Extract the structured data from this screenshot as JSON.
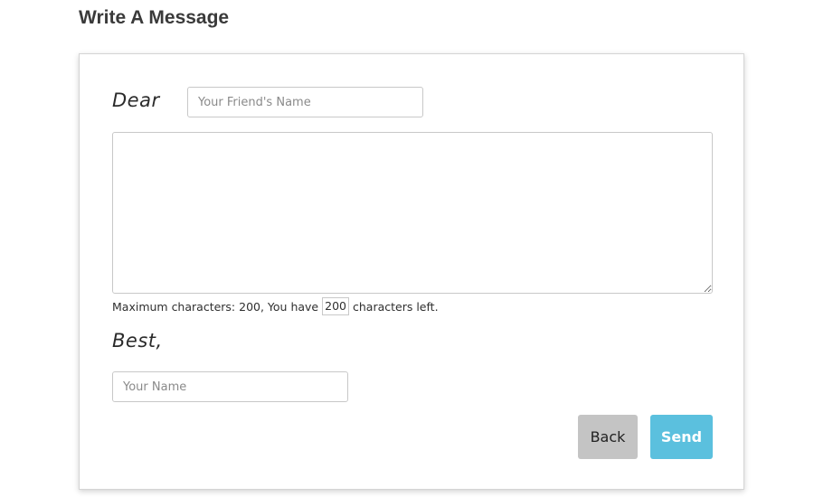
{
  "page": {
    "title": "Write A Message"
  },
  "form": {
    "greeting_label": "Dear",
    "friend_name_placeholder": "Your Friend's Name",
    "friend_name_value": "",
    "message_value": "",
    "counter": {
      "prefix": "Maximum characters: 200, You have",
      "remaining": "200",
      "suffix": "characters left."
    },
    "closing_label": "Best,",
    "your_name_placeholder": "Your Name",
    "your_name_value": ""
  },
  "actions": {
    "back_label": "Back",
    "send_label": "Send"
  },
  "colors": {
    "send_button": "#5bc0de",
    "back_button": "#c4c4c4"
  }
}
